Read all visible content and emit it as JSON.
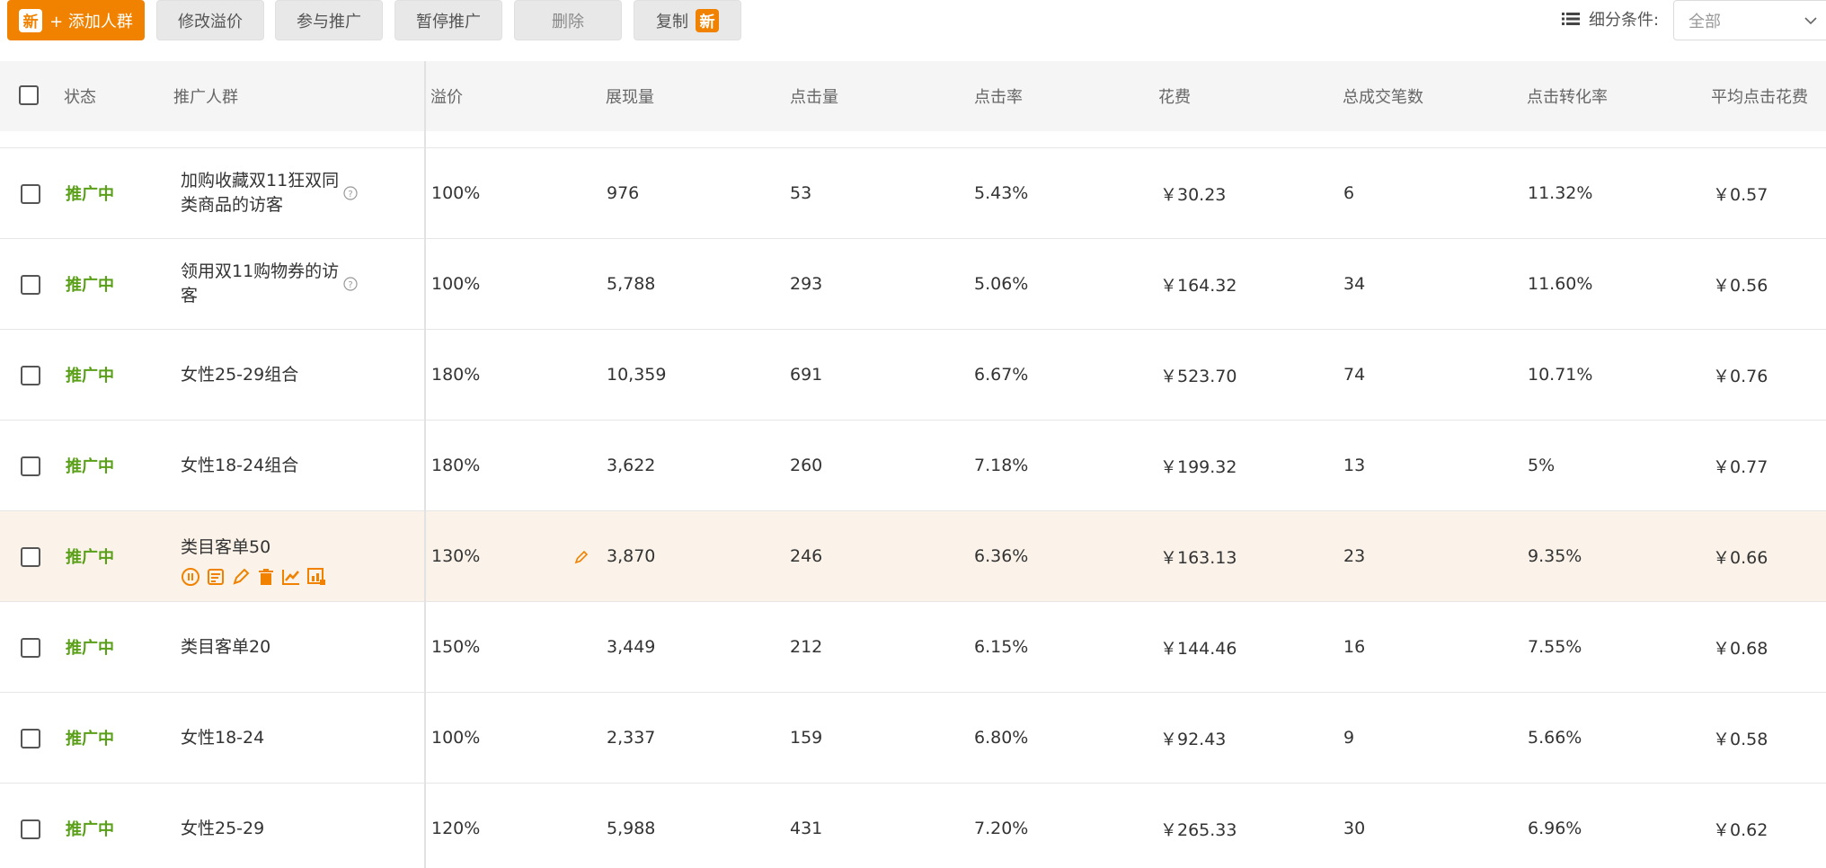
{
  "toolbar": {
    "add_button": {
      "tag": "新",
      "label": "+ 添加人群"
    },
    "buttons": [
      {
        "label": "修改溢价"
      },
      {
        "label": "参与推广"
      },
      {
        "label": "暂停推广"
      },
      {
        "label": "删除"
      },
      {
        "label": "复制",
        "tag": "新"
      }
    ],
    "filter_label": "细分条件:",
    "filter_value": "全部"
  },
  "table": {
    "columns": [
      "状态",
      "推广人群",
      "溢价",
      "展现量",
      "点击量",
      "点击率",
      "花费",
      "总成交笔数",
      "点击转化率",
      "平均点击花费"
    ],
    "rows": [
      {
        "status": "推广中",
        "name": "加购收藏双11狂双同类商品的访客",
        "premium": "100%",
        "impressions": "976",
        "clicks": "53",
        "ctr": "5.43%",
        "cost": "￥30.23",
        "orders": "6",
        "cvr": "11.32%",
        "cpc": "￥0.57",
        "has_help": true
      },
      {
        "status": "推广中",
        "name": "领用双11购物券的访客",
        "premium": "100%",
        "impressions": "5,788",
        "clicks": "293",
        "ctr": "5.06%",
        "cost": "￥164.32",
        "orders": "34",
        "cvr": "11.60%",
        "cpc": "￥0.56",
        "has_help": true
      },
      {
        "status": "推广中",
        "name": "女性25-29组合",
        "premium": "180%",
        "impressions": "10,359",
        "clicks": "691",
        "ctr": "6.67%",
        "cost": "￥523.70",
        "orders": "74",
        "cvr": "10.71%",
        "cpc": "￥0.76"
      },
      {
        "status": "推广中",
        "name": "女性18-24组合",
        "premium": "180%",
        "impressions": "3,622",
        "clicks": "260",
        "ctr": "7.18%",
        "cost": "￥199.32",
        "orders": "13",
        "cvr": "5%",
        "cpc": "￥0.77"
      },
      {
        "status": "推广中",
        "name": "类目客单50",
        "premium": "130%",
        "impressions": "3,870",
        "clicks": "246",
        "ctr": "6.36%",
        "cost": "￥163.13",
        "orders": "23",
        "cvr": "9.35%",
        "cpc": "￥0.66",
        "highlighted": true
      },
      {
        "status": "推广中",
        "name": "类目客单20",
        "premium": "150%",
        "impressions": "3,449",
        "clicks": "212",
        "ctr": "6.15%",
        "cost": "￥144.46",
        "orders": "16",
        "cvr": "7.55%",
        "cpc": "￥0.68"
      },
      {
        "status": "推广中",
        "name": "女性18-24",
        "premium": "100%",
        "impressions": "2,337",
        "clicks": "159",
        "ctr": "6.80%",
        "cost": "￥92.43",
        "orders": "9",
        "cvr": "5.66%",
        "cpc": "￥0.58"
      },
      {
        "status": "推广中",
        "name": "女性25-29",
        "premium": "120%",
        "impressions": "5,988",
        "clicks": "431",
        "ctr": "7.20%",
        "cost": "￥265.33",
        "orders": "30",
        "cvr": "6.96%",
        "cpc": "￥0.62"
      }
    ]
  },
  "row_action_icons": [
    "pause-icon",
    "report-icon",
    "edit-icon",
    "delete-icon",
    "trend-chart-icon",
    "data-report-icon"
  ],
  "colors": {
    "accent": "#f08200",
    "status_active": "#5a9f18",
    "highlight_row": "#fbf3ea"
  }
}
